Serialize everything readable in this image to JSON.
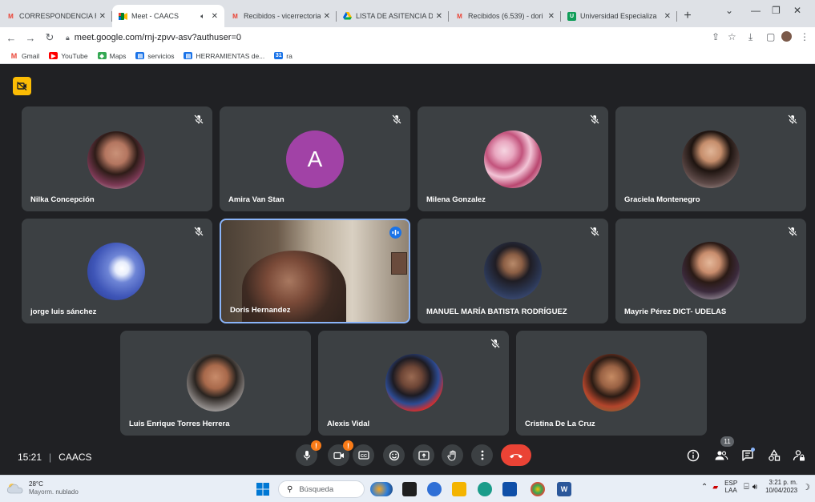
{
  "browser": {
    "tabs": [
      {
        "label": "CORRESPONDENCIA RE",
        "icon": "gmail-icon",
        "active": false
      },
      {
        "label": "Meet - CAACS",
        "icon": "meet-icon",
        "active": true
      },
      {
        "label": "Recibidos - vicerrectoria",
        "icon": "gmail-icon",
        "active": false
      },
      {
        "label": "LISTA DE ASITENCIA DE",
        "icon": "drive-icon",
        "active": false
      },
      {
        "label": "Recibidos (6.539) - dori",
        "icon": "gmail-icon",
        "active": false
      },
      {
        "label": "Universidad Especializa",
        "icon": "classroom-icon",
        "active": false
      }
    ],
    "url": "meet.google.com/rnj-zpvv-asv?authuser=0",
    "bookmarks": [
      {
        "label": "Gmail",
        "icon": "gmail-icon",
        "color": "#ea4335"
      },
      {
        "label": "YouTube",
        "icon": "youtube-icon",
        "color": "#ff0000"
      },
      {
        "label": "Maps",
        "icon": "maps-icon",
        "color": "#34a853"
      },
      {
        "label": "servicios",
        "icon": "docs-icon",
        "color": "#1a73e8"
      },
      {
        "label": "HERRAMIENTAS de...",
        "icon": "docs-icon",
        "color": "#1a73e8"
      },
      {
        "label": "ra",
        "icon": "calendar-icon",
        "color": "#1a73e8"
      }
    ]
  },
  "meet": {
    "participants": [
      {
        "name": "Nilka Concepción",
        "avatar": "photo",
        "muted": true
      },
      {
        "name": "Amira Van Stan",
        "avatar": "letter",
        "letter": "A",
        "muted": true
      },
      {
        "name": "Milena Gonzalez",
        "avatar": "photo",
        "muted": true
      },
      {
        "name": "Graciela Montenegro",
        "avatar": "photo",
        "muted": true
      },
      {
        "name": "jorge luis sánchez",
        "avatar": "photo",
        "muted": true
      },
      {
        "name": "Doris Hernandez",
        "avatar": "video",
        "muted": false,
        "speaking": true
      },
      {
        "name": "MANUEL MARÍA BATISTA RODRÍGUEZ",
        "avatar": "photo",
        "muted": true
      },
      {
        "name": "Mayrie Pérez DICT- UDELAS",
        "avatar": "photo",
        "muted": true
      },
      {
        "name": "Luis Enrique Torres Herrera",
        "avatar": "photo",
        "muted": false
      },
      {
        "name": "Alexis Vidal",
        "avatar": "photo",
        "muted": true
      },
      {
        "name": "Cristina De La Cruz",
        "avatar": "photo",
        "muted": false
      }
    ],
    "time": "15:21",
    "meeting_code": "CAACS",
    "participant_count": "11",
    "colors": {
      "accent": "#8ab4f8",
      "end_call": "#ea4335",
      "warning": "#fa7b17",
      "letter_avatar": "#a142a6"
    }
  },
  "taskbar": {
    "weather_temp": "28°C",
    "weather_desc": "Mayorm. nublado",
    "search_placeholder": "Búsqueda",
    "lang_top": "ESP",
    "lang_bottom": "LAA",
    "clock_time": "3:21 p. m.",
    "clock_date": "10/04/2023"
  }
}
